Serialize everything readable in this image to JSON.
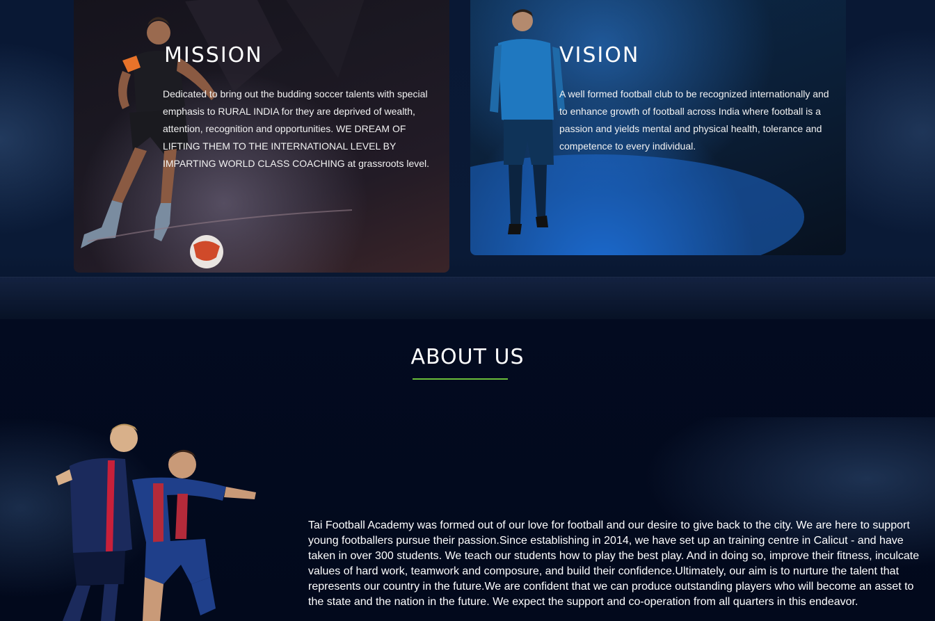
{
  "mission": {
    "title": "MISSION",
    "text": "Dedicated to bring out the budding soccer talents with special emphasis to RURAL INDIA for they are deprived of wealth, attention, recognition and opportunities. WE DREAM OF LIFTING THEM TO THE INTERNATIONAL LEVEL BY IMPARTING WORLD CLASS COACHING at grassroots level."
  },
  "vision": {
    "title": "VISION",
    "text": "A well formed football club to be recognized internationally and to enhance growth of football across India where football is a passion and yields mental and physical health, tolerance and competence to every individual."
  },
  "about": {
    "title": "ABOUT US",
    "text": "Tai Football Academy was formed out of our love for football and our desire to give back to the city. We are here to support young footballers pursue their passion.Since establishing in 2014, we have set up an training centre in Calicut - and have taken in over 300 students. We teach our students how to play the best play. And in doing so, improve their fitness, inculcate values of hard work, teamwork and composure, and build their confidence.Ultimately, our aim is to nurture the talent that represents our country in the future.We are confident that we can produce outstanding players who will become an asset to the state and the nation in the future. We expect the support and co-operation from all quarters in this endeavor."
  },
  "colors": {
    "background": "#020a1e",
    "accent_underline": "#6bbf3a",
    "text": "#ffffff"
  }
}
